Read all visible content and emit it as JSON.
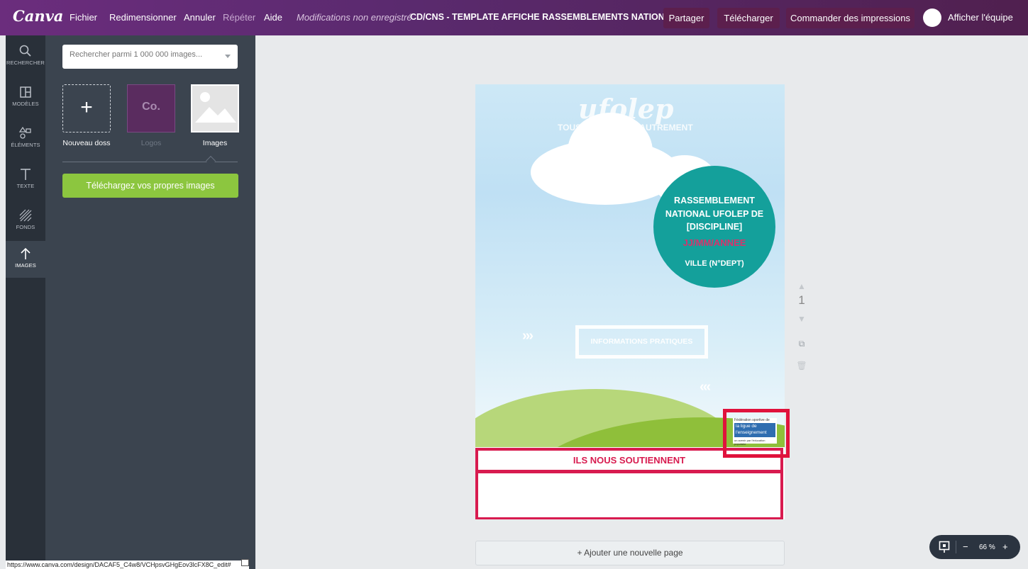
{
  "topbar": {
    "logo": "Canva",
    "menu": [
      "Fichier",
      "Redimensionner",
      "Annuler",
      "Répéter",
      "Aide"
    ],
    "status": "Modifications non enregistrées",
    "doc_title": "CD/CNS - TEMPLATE AFFICHE RASSEMBLEMENTS NATIONAUX",
    "share": "Partager",
    "download": "Télécharger",
    "print": "Commander des impressions",
    "team": "Afficher l'équipe"
  },
  "rail": [
    {
      "label": "RECHERCHER",
      "icon": "search-icon"
    },
    {
      "label": "MODÈLES",
      "icon": "layout-icon"
    },
    {
      "label": "ÉLÉMENTS",
      "icon": "shapes-icon"
    },
    {
      "label": "TEXTE",
      "icon": "text-icon"
    },
    {
      "label": "FONDS",
      "icon": "pattern-icon"
    },
    {
      "label": "IMAGES",
      "icon": "upload-arrow-icon"
    }
  ],
  "panel": {
    "search_placeholder": "Rechercher parmi 1 000 000 images...",
    "folders": [
      {
        "label": "Nouveau doss",
        "thumb": "+"
      },
      {
        "label": "Logos",
        "thumb": "Co."
      },
      {
        "label": "Images",
        "thumb": ""
      }
    ],
    "upload": "Téléchargez vos propres images"
  },
  "poster": {
    "brand": "ufolep",
    "tagline": "TOUS LES SPORTS AUTREMENT",
    "badge_title": "RASSEMBLEMENT NATIONAL UFOLEP DE [DISCIPLINE]",
    "badge_date": "JJ/MM/ANNEE",
    "badge_city": "VILLE (N°DEPT)",
    "arrows_right": "›››",
    "arrows_left": "‹‹‹",
    "info": "INFORMATIONS PRATIQUES",
    "ligue_top": "Fédération sportive de",
    "ligue_mid": "la ligue de l'enseignement",
    "ligue_bot": "un avenir par l'éducation populaire",
    "sponsors": "ILS NOUS SOUTIENNENT"
  },
  "page_number": "1",
  "add_page": "+ Ajouter une nouvelle page",
  "zoom": {
    "minus": "−",
    "level": "66 %",
    "plus": "+"
  },
  "status_url": "https://www.canva.com/design/DACAF5_C4w8/VCHpsvGHgEov3lcFX8C_edit#"
}
